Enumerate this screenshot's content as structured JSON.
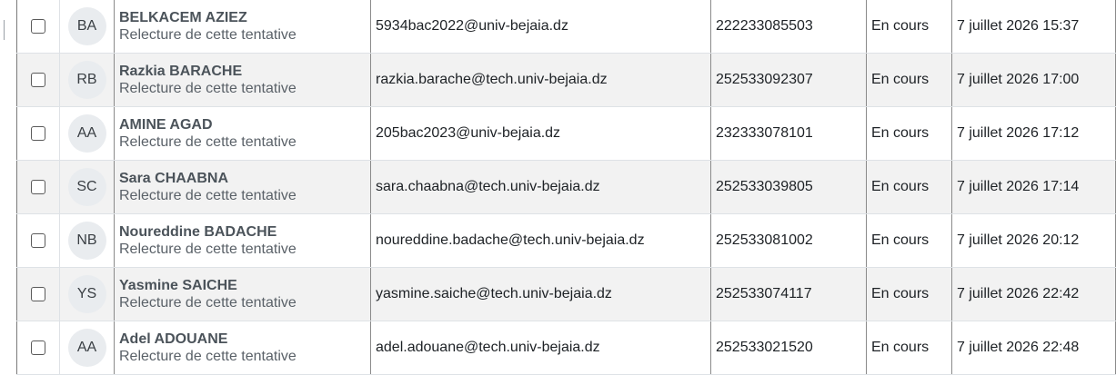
{
  "attempts": [
    {
      "initials": "BA",
      "name": "BELKACEM AZIEZ",
      "review": "Relecture de cette tentative",
      "email": "5934bac2022@univ-bejaia.dz",
      "id": "222233085503",
      "status": "En cours",
      "started": "7 juillet 2026 15:37"
    },
    {
      "initials": "RB",
      "name": "Razkia BARACHE",
      "review": "Relecture de cette tentative",
      "email": "razkia.barache@tech.univ-bejaia.dz",
      "id": "252533092307",
      "status": "En cours",
      "started": "7 juillet 2026 17:00"
    },
    {
      "initials": "AA",
      "name": "AMINE AGAD",
      "review": "Relecture de cette tentative",
      "email": "205bac2023@univ-bejaia.dz",
      "id": "232333078101",
      "status": "En cours",
      "started": "7 juillet 2026 17:12"
    },
    {
      "initials": "SC",
      "name": "Sara CHAABNA",
      "review": "Relecture de cette tentative",
      "email": "sara.chaabna@tech.univ-bejaia.dz",
      "id": "252533039805",
      "status": "En cours",
      "started": "7 juillet 2026 17:14"
    },
    {
      "initials": "NB",
      "name": "Noureddine BADACHE",
      "review": "Relecture de cette tentative",
      "email": "noureddine.badache@tech.univ-bejaia.dz",
      "id": "252533081002",
      "status": "En cours",
      "started": "7 juillet 2026 20:12"
    },
    {
      "initials": "YS",
      "name": "Yasmine SAICHE",
      "review": "Relecture de cette tentative",
      "email": "yasmine.saiche@tech.univ-bejaia.dz",
      "id": "252533074117",
      "status": "En cours",
      "started": "7 juillet 2026 22:42"
    },
    {
      "initials": "AA",
      "name": "Adel ADOUANE",
      "review": "Relecture de cette tentative",
      "email": "adel.adouane@tech.univ-bejaia.dz",
      "id": "252533021520",
      "status": "En cours",
      "started": "7 juillet 2026 22:48"
    }
  ]
}
